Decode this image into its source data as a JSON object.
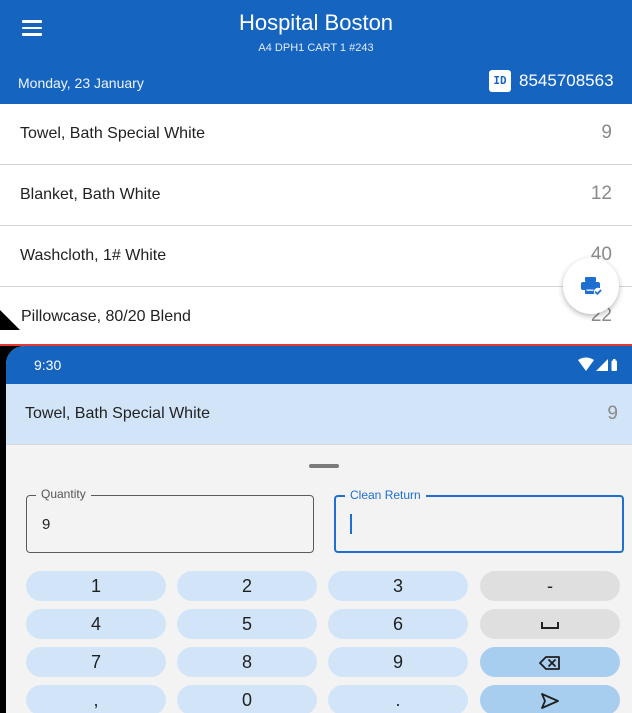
{
  "header": {
    "title": "Hospital Boston",
    "subtitle": "A4 DPH1 CART 1 #243",
    "date": "Monday, 23 January",
    "id_badge": "ID",
    "id_number": "8545708563"
  },
  "items": [
    {
      "name": "Towel, Bath Special White",
      "qty": "9"
    },
    {
      "name": "Blanket, Bath White",
      "qty": "12"
    },
    {
      "name": "Washcloth, 1# White",
      "qty": "40"
    },
    {
      "name": "Pillowcase, 80/20 Blend",
      "qty": "22"
    }
  ],
  "fab": {
    "icon": "print-check-icon"
  },
  "status_bar": {
    "time": "9:30",
    "icons": [
      "wifi-icon",
      "signal-icon",
      "battery-icon"
    ]
  },
  "selected_item": {
    "name": "Towel, Bath Special White",
    "qty": "9"
  },
  "form": {
    "quantity": {
      "label": "Quantity",
      "value": "9"
    },
    "clean_return": {
      "label": "Clean Return",
      "value": ""
    }
  },
  "keypad": {
    "k1": "1",
    "k2": "2",
    "k3": "3",
    "minus": "-",
    "k4": "4",
    "k5": "5",
    "k6": "6",
    "space_icon": "space-icon",
    "k7": "7",
    "k8": "8",
    "k9": "9",
    "backspace_icon": "backspace-icon",
    "comma": ",",
    "k0": "0",
    "dot": ".",
    "send_icon": "send-icon"
  },
  "colors": {
    "primary": "#1565c0",
    "selected_row": "#d2e5f8",
    "key_light": "#d2e5f8",
    "key_gray": "#dfdfdf",
    "key_blue": "#a8ceef",
    "focus": "#1e6fd0"
  }
}
